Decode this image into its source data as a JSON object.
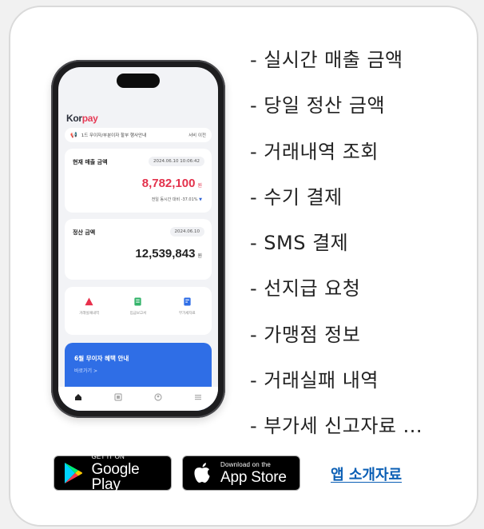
{
  "phone": {
    "logo_k": "Kor",
    "logo_p": "pay",
    "notice_text": "1드 무이자/부분이자 할부 행사안내",
    "notice_button": "서비 이전",
    "sales_panel": {
      "title": "현재 매출 금액",
      "timestamp": "2024.06.10 10:06:42",
      "amount": "8,782,100",
      "unit": "원",
      "compare_text": "전일 동시간 대비 -37.01%",
      "compare_arrow": "▼"
    },
    "settle_panel": {
      "title": "정산 금액",
      "date": "2024.06.10",
      "amount": "12,539,843",
      "unit": "원"
    },
    "quick_menu": [
      {
        "label": "거래실패내역",
        "icon": "warning-icon",
        "color": "#e8304c"
      },
      {
        "label": "입금보고서",
        "icon": "report-icon",
        "color": "#35b46b"
      },
      {
        "label": "부가세자료",
        "icon": "document-icon",
        "color": "#2f6ee6"
      }
    ],
    "promo": {
      "title": "6월 무이자 혜택 안내",
      "link": "바로가기 >"
    },
    "tabbar": [
      "home-icon",
      "grid-icon",
      "profile-icon",
      "menu-icon"
    ]
  },
  "features": [
    "- 실시간 매출 금액",
    "- 당일 정산 금액",
    "- 거래내역 조회",
    "- 수기 결제",
    "- SMS 결제",
    "- 선지급 요청",
    "- 가맹점 정보",
    "- 거래실패 내역",
    "- 부가세 신고자료 ..."
  ],
  "badges": {
    "google_small": "GET IT ON",
    "google_big": "Google Play",
    "apple_small": "Download on the",
    "apple_big": "App Store"
  },
  "intro_link": "앱 소개자료",
  "colors": {
    "accent_red": "#e3324c",
    "accent_blue": "#2f6ee6",
    "link": "#0b5fb5"
  }
}
